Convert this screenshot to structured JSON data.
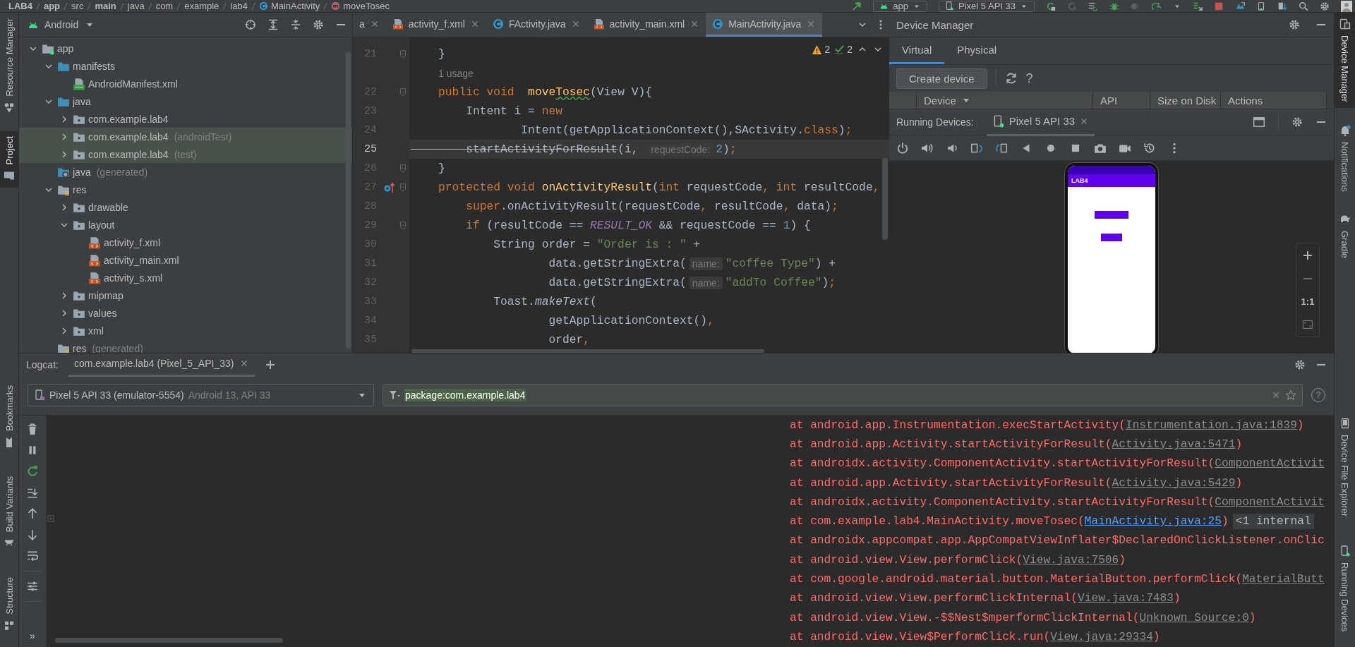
{
  "breadcrumb": [
    {
      "label": "LAB4",
      "kind": "root"
    },
    {
      "label": "app",
      "kind": "module"
    },
    {
      "label": "src",
      "kind": "dir"
    },
    {
      "label": "main",
      "kind": "source"
    },
    {
      "label": "java",
      "kind": "dir"
    },
    {
      "label": "com",
      "kind": "dir"
    },
    {
      "label": "example",
      "kind": "dir"
    },
    {
      "label": "lab4",
      "kind": "dir"
    },
    {
      "label": "MainActivity",
      "kind": "class"
    },
    {
      "label": "moveTosec",
      "kind": "method"
    }
  ],
  "run_config": {
    "label": "app"
  },
  "device_select": {
    "label": "Pixel 5 API 33"
  },
  "left_strip": {
    "top": [
      {
        "label": "Resource Manager",
        "selected": false
      },
      {
        "label": "Project",
        "selected": true
      }
    ],
    "bottom": [
      {
        "label": "Bookmarks",
        "selected": false
      },
      {
        "label": "Build Variants",
        "selected": false
      },
      {
        "label": "Structure",
        "selected": false
      }
    ]
  },
  "right_strip": {
    "top": [
      {
        "label": "Device Manager",
        "selected": true
      },
      {
        "label": "Notifications",
        "selected": false
      },
      {
        "label": "Gradle",
        "selected": false
      }
    ],
    "bottom": [
      {
        "label": "Device File Explorer",
        "selected": false
      },
      {
        "label": "Running Devices",
        "selected": false
      }
    ]
  },
  "project": {
    "view": "Android",
    "tree": [
      {
        "label": "app",
        "kind": "module",
        "expanded": true,
        "highlighted": false,
        "children": [
          {
            "label": "manifests",
            "kind": "source",
            "expanded": true,
            "highlighted": false,
            "children": [
              {
                "label": "AndroidManifest.xml",
                "kind": "manifest",
                "highlighted": false
              }
            ]
          },
          {
            "label": "java",
            "kind": "source",
            "expanded": true,
            "highlighted": false,
            "children": [
              {
                "label": "com.example.lab4",
                "kind": "package",
                "expanded": false,
                "highlighted": false
              },
              {
                "label": "com.example.lab4",
                "note": "(androidTest)",
                "kind": "package",
                "expanded": false,
                "highlighted": true
              },
              {
                "label": "com.example.lab4",
                "note": "(test)",
                "kind": "package",
                "expanded": false,
                "highlighted": true
              }
            ]
          },
          {
            "label": "java",
            "note": "(generated)",
            "kind": "generated",
            "highlighted": false
          },
          {
            "label": "res",
            "kind": "resources",
            "expanded": true,
            "highlighted": false,
            "children": [
              {
                "label": "drawable",
                "kind": "package",
                "expanded": false,
                "highlighted": false
              },
              {
                "label": "layout",
                "kind": "package",
                "expanded": true,
                "highlighted": false,
                "children": [
                  {
                    "label": "activity_f.xml",
                    "kind": "xml",
                    "highlighted": false
                  },
                  {
                    "label": "activity_main.xml",
                    "kind": "xml",
                    "highlighted": false
                  },
                  {
                    "label": "activity_s.xml",
                    "kind": "xml",
                    "highlighted": false
                  }
                ]
              },
              {
                "label": "mipmap",
                "kind": "package",
                "expanded": false,
                "highlighted": false
              },
              {
                "label": "values",
                "kind": "package",
                "expanded": false,
                "highlighted": false
              },
              {
                "label": "xml",
                "kind": "package",
                "expanded": false,
                "highlighted": false
              }
            ]
          },
          {
            "label": "res",
            "note": "(generated)",
            "kind": "resources",
            "highlighted": false
          }
        ]
      }
    ]
  },
  "editor": {
    "tabs": [
      {
        "label": "a",
        "kind": "cut",
        "selected": false
      },
      {
        "label": "activity_f.xml",
        "kind": "xml",
        "selected": false
      },
      {
        "label": "FActivity.java",
        "kind": "class",
        "selected": false
      },
      {
        "label": "activity_main.xml",
        "kind": "xml",
        "selected": false
      },
      {
        "label": "MainActivity.java",
        "kind": "class",
        "selected": true
      }
    ],
    "inspections": {
      "warnings": "2",
      "typos": "2"
    },
    "lines": [
      {
        "kind": "code",
        "number": "21",
        "current": false,
        "fold": true,
        "override": false,
        "tokens": [
          {
            "text": "    }",
            "kind": "plain"
          }
        ]
      },
      {
        "kind": "usage",
        "text": "1 usage"
      },
      {
        "kind": "code",
        "number": "22",
        "current": false,
        "fold": true,
        "override": false,
        "tokens": [
          {
            "text": "    public void  ",
            "kind": "keyword"
          },
          {
            "text": "move",
            "kind": "declaration"
          },
          {
            "text": "Tosec",
            "kind": "typo"
          },
          {
            "text": "(View V){",
            "kind": "plain"
          }
        ]
      },
      {
        "kind": "code",
        "number": "23",
        "current": false,
        "fold": false,
        "override": false,
        "tokens": [
          {
            "text": "        Intent i = ",
            "kind": "plain"
          },
          {
            "text": "new",
            "kind": "keyword"
          }
        ]
      },
      {
        "kind": "code",
        "number": "24",
        "current": false,
        "fold": false,
        "override": false,
        "tokens": [
          {
            "text": "                Intent(getApplicationContext(),SActivity.",
            "kind": "plain"
          },
          {
            "text": "class",
            "kind": "keyword"
          },
          {
            "text": ")",
            "kind": "plain"
          },
          {
            "text": ";",
            "kind": "keyword"
          }
        ]
      },
      {
        "kind": "code",
        "number": "25",
        "current": true,
        "fold": false,
        "override": false,
        "tokens": [
          {
            "text": "        startActivityForResult",
            "kind": "deprecated"
          },
          {
            "text": "(i, ",
            "kind": "plain"
          },
          {
            "text": "requestCode:",
            "kind": "hint"
          },
          {
            "text": "2",
            "kind": "number"
          },
          {
            "text": ")",
            "kind": "plain"
          },
          {
            "text": ";",
            "kind": "keyword"
          }
        ]
      },
      {
        "kind": "code",
        "number": "26",
        "current": false,
        "fold": true,
        "override": false,
        "tokens": [
          {
            "text": "    }",
            "kind": "plain"
          }
        ]
      },
      {
        "kind": "code",
        "number": "27",
        "current": false,
        "fold": true,
        "override": true,
        "tokens": [
          {
            "text": "    protected void ",
            "kind": "keyword"
          },
          {
            "text": "onActivityResult",
            "kind": "declaration"
          },
          {
            "text": "(",
            "kind": "plain"
          },
          {
            "text": "int",
            "kind": "keyword"
          },
          {
            "text": " requestCode",
            "kind": "plain"
          },
          {
            "text": ", int",
            "kind": "keyword"
          },
          {
            "text": " resultCode",
            "kind": "plain"
          },
          {
            "text": ",",
            "kind": "keyword"
          }
        ]
      },
      {
        "kind": "code",
        "number": "28",
        "current": false,
        "fold": false,
        "override": false,
        "tokens": [
          {
            "text": "        super",
            "kind": "keyword"
          },
          {
            "text": ".onActivityResult(requestCode",
            "kind": "plain"
          },
          {
            "text": ",",
            "kind": "keyword"
          },
          {
            "text": " resultCode",
            "kind": "plain"
          },
          {
            "text": ",",
            "kind": "keyword"
          },
          {
            "text": " data)",
            "kind": "plain"
          },
          {
            "text": ";",
            "kind": "keyword"
          }
        ]
      },
      {
        "kind": "code",
        "number": "29",
        "current": false,
        "fold": true,
        "override": false,
        "tokens": [
          {
            "text": "        if",
            "kind": "keyword"
          },
          {
            "text": " (resultCode == ",
            "kind": "plain"
          },
          {
            "text": "RESULT_OK",
            "kind": "constant"
          },
          {
            "text": " && requestCode == ",
            "kind": "plain"
          },
          {
            "text": "1",
            "kind": "number"
          },
          {
            "text": ") {",
            "kind": "plain"
          }
        ]
      },
      {
        "kind": "code",
        "number": "30",
        "current": false,
        "fold": false,
        "override": false,
        "tokens": [
          {
            "text": "            String order = ",
            "kind": "plain"
          },
          {
            "text": "\"Order is : \"",
            "kind": "string"
          },
          {
            "text": " +",
            "kind": "plain"
          }
        ]
      },
      {
        "kind": "code",
        "number": "31",
        "current": false,
        "fold": false,
        "override": false,
        "tokens": [
          {
            "text": "                    data.getStringExtra(",
            "kind": "plain"
          },
          {
            "text": "name:",
            "kind": "hint"
          },
          {
            "text": "\"coffee Type\"",
            "kind": "string"
          },
          {
            "text": ") +",
            "kind": "plain"
          }
        ]
      },
      {
        "kind": "code",
        "number": "32",
        "current": false,
        "fold": false,
        "override": false,
        "tokens": [
          {
            "text": "                    data.getStringExtra(",
            "kind": "plain"
          },
          {
            "text": "name:",
            "kind": "hint"
          },
          {
            "text": "\"addTo Coffee\"",
            "kind": "string"
          },
          {
            "text": ")",
            "kind": "plain"
          },
          {
            "text": ";",
            "kind": "keyword"
          }
        ]
      },
      {
        "kind": "code",
        "number": "33",
        "current": false,
        "fold": false,
        "override": false,
        "tokens": [
          {
            "text": "            Toast.",
            "kind": "plain"
          },
          {
            "text": "makeText",
            "kind": "static"
          },
          {
            "text": "(",
            "kind": "plain"
          }
        ]
      },
      {
        "kind": "code",
        "number": "34",
        "current": false,
        "fold": false,
        "override": false,
        "tokens": [
          {
            "text": "                    getApplicationContext()",
            "kind": "plain"
          },
          {
            "text": ",",
            "kind": "keyword"
          }
        ]
      },
      {
        "kind": "code",
        "number": "35",
        "current": false,
        "fold": false,
        "override": false,
        "tokens": [
          {
            "text": "                    order",
            "kind": "plain"
          },
          {
            "text": ",",
            "kind": "keyword"
          }
        ]
      }
    ]
  },
  "device_manager": {
    "title": "Device Manager",
    "tabs": [
      {
        "label": "Virtual",
        "selected": true
      },
      {
        "label": "Physical",
        "selected": false
      }
    ],
    "create_button": "Create device",
    "help": "?",
    "columns": [
      "Device",
      "API",
      "Size on Disk",
      "Actions"
    ]
  },
  "running_devices": {
    "label": "Running Devices:",
    "tabs": [
      {
        "label": "Pixel 5 API 33",
        "selected": true
      }
    ],
    "emulator": {
      "app_title": "LAB4"
    },
    "zoom_reset": "1:1"
  },
  "logcat": {
    "label": "Logcat:",
    "tabs": [
      {
        "label": "com.example.lab4 (Pixel_5_API_33)",
        "selected": true
      }
    ],
    "device": {
      "name": "Pixel 5 API 33 (emulator-5554)",
      "detail": "Android 13, API 33"
    },
    "filter": {
      "value": "package:com.example.lab4"
    },
    "help": "?",
    "more": "»",
    "lines": [
      [
        {
          "text": "at android.app.Instrumentation.execStartActivity(",
          "kind": "plain"
        },
        {
          "text": "Instrumentation.java:1839",
          "kind": "link"
        },
        {
          "text": ")",
          "kind": "plain"
        }
      ],
      [
        {
          "text": "at android.app.Activity.startActivityForResult(",
          "kind": "plain"
        },
        {
          "text": "Activity.java:5471",
          "kind": "link"
        },
        {
          "text": ")",
          "kind": "plain"
        }
      ],
      [
        {
          "text": "at androidx.activity.ComponentActivity.startActivityForResult(",
          "kind": "plain"
        },
        {
          "text": "ComponentActivit",
          "kind": "link"
        }
      ],
      [
        {
          "text": "at android.app.Activity.startActivityForResult(",
          "kind": "plain"
        },
        {
          "text": "Activity.java:5429",
          "kind": "link"
        },
        {
          "text": ")",
          "kind": "plain"
        }
      ],
      [
        {
          "text": "at androidx.activity.ComponentActivity.startActivityForResult(",
          "kind": "plain"
        },
        {
          "text": "ComponentActivit",
          "kind": "link"
        }
      ],
      [
        {
          "text": "at com.example.lab4.MainActivity.moveTosec(",
          "kind": "plain"
        },
        {
          "text": "MainActivity.java:25",
          "kind": "project-link"
        },
        {
          "text": ")",
          "kind": "plain"
        },
        {
          "text": "<1 internal",
          "kind": "folded"
        }
      ],
      [
        {
          "text": "at androidx.appcompat.app.AppCompatViewInflater$DeclaredOnClickListener.onClic",
          "kind": "plain"
        }
      ],
      [
        {
          "text": "at android.view.View.performClick(",
          "kind": "plain"
        },
        {
          "text": "View.java:7506",
          "kind": "link"
        },
        {
          "text": ")",
          "kind": "plain"
        }
      ],
      [
        {
          "text": "at com.google.android.material.button.MaterialButton.performClick(",
          "kind": "plain"
        },
        {
          "text": "MaterialButt",
          "kind": "link"
        }
      ],
      [
        {
          "text": "at android.view.View.performClickInternal(",
          "kind": "plain"
        },
        {
          "text": "View.java:7483",
          "kind": "link"
        },
        {
          "text": ")",
          "kind": "plain"
        }
      ],
      [
        {
          "text": "at android.view.View.-$$Nest$mperformClickInternal(",
          "kind": "plain"
        },
        {
          "text": "Unknown Source:0",
          "kind": "link"
        },
        {
          "text": ")",
          "kind": "plain"
        }
      ],
      [
        {
          "text": "at android.view.View$PerformClick.run(",
          "kind": "plain"
        },
        {
          "text": "View.java:29334",
          "kind": "link"
        },
        {
          "text": ")",
          "kind": "plain"
        }
      ]
    ]
  }
}
